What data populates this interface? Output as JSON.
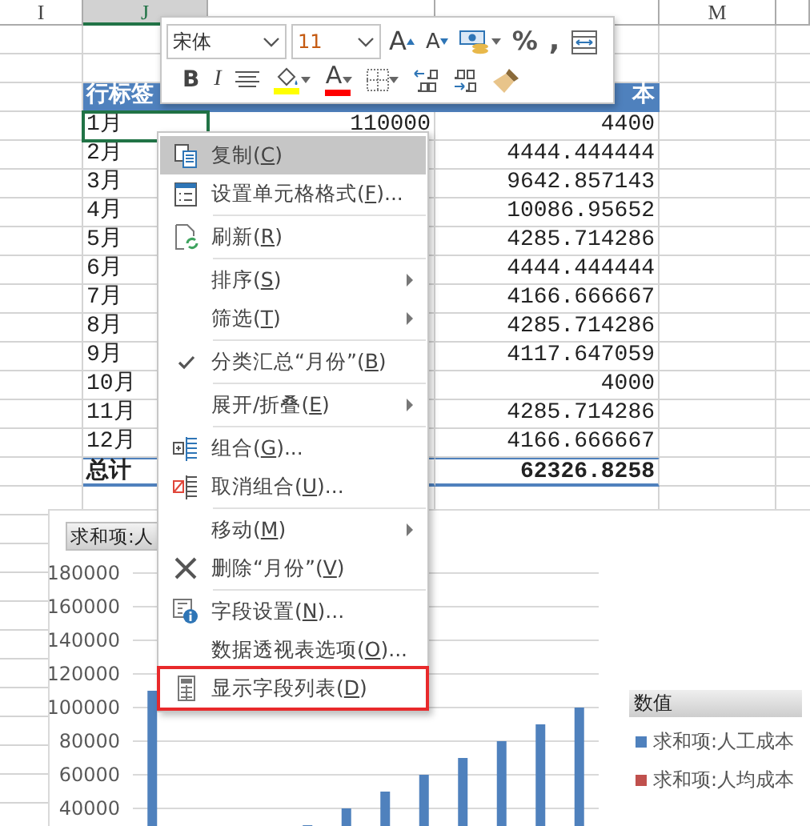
{
  "columns": [
    {
      "label": "I",
      "selected": false
    },
    {
      "label": "J",
      "selected": true
    },
    {
      "selected": false
    },
    {
      "selected": false
    },
    {
      "label": "M",
      "selected": false
    }
  ],
  "pivot": {
    "row_header": "行标签",
    "value_header_tail": "本",
    "rows": [
      {
        "label": "1月",
        "column_k": "110000",
        "column_l": "4400",
        "selected": true
      },
      {
        "label": "2月",
        "column_l": "4444.444444",
        "selected": false
      },
      {
        "label": "3月",
        "column_l": "9642.857143",
        "selected": false
      },
      {
        "label": "4月",
        "column_l": "10086.95652",
        "selected": false
      },
      {
        "label": "5月",
        "column_l": "4285.714286",
        "selected": false
      },
      {
        "label": "6月",
        "column_l": "4444.444444",
        "selected": false
      },
      {
        "label": "7月",
        "column_l": "4166.666667",
        "selected": false
      },
      {
        "label": "8月",
        "column_l": "4285.714286",
        "selected": false
      },
      {
        "label": "9月",
        "column_l": "4117.647059",
        "selected": false
      },
      {
        "label": "10月",
        "column_l": "4000",
        "selected": false
      },
      {
        "label": "11月",
        "column_l": "4285.714286",
        "selected": false
      },
      {
        "label": "12月",
        "column_l": "4166.666667",
        "selected": false
      }
    ],
    "total": {
      "label": "总计",
      "column_l": "62326.8258"
    }
  },
  "mini_toolbar": {
    "font": "宋体",
    "size": "11",
    "grow_glyph": "A",
    "shrink_glyph": "A",
    "percent_glyph": "%",
    "comma_glyph": ",",
    "bold_glyph": "B",
    "italic_glyph": "I",
    "font_color_glyph": "A"
  },
  "context_menu": {
    "items": [
      {
        "kind": "copy",
        "before": "复制(",
        "key": "C",
        "after": ")",
        "checked": false,
        "submenu": false,
        "selected": true,
        "outlined": false
      },
      {
        "kind": "format",
        "before": "设置单元格格式(",
        "key": "F",
        "after": ")...",
        "checked": false,
        "submenu": false,
        "selected": false,
        "outlined": false
      },
      {
        "kind": "separator"
      },
      {
        "kind": "refresh",
        "before": "刷新(",
        "key": "R",
        "after": ")",
        "checked": false,
        "submenu": false,
        "selected": false,
        "outlined": false
      },
      {
        "kind": "separator"
      },
      {
        "kind": "plain",
        "before": "排序(",
        "key": "S",
        "after": ")",
        "checked": false,
        "submenu": true,
        "selected": false,
        "outlined": false
      },
      {
        "kind": "plain",
        "before": "筛选(",
        "key": "T",
        "after": ")",
        "checked": false,
        "submenu": true,
        "selected": false,
        "outlined": false
      },
      {
        "kind": "separator"
      },
      {
        "kind": "plain",
        "before": "分类汇总“月份”(",
        "key": "B",
        "after": ")",
        "checked": true,
        "submenu": false,
        "selected": false,
        "outlined": false
      },
      {
        "kind": "separator"
      },
      {
        "kind": "plain",
        "before": "展开/折叠(",
        "key": "E",
        "after": ")",
        "checked": false,
        "submenu": true,
        "selected": false,
        "outlined": false
      },
      {
        "kind": "separator"
      },
      {
        "kind": "group",
        "before": "组合(",
        "key": "G",
        "after": ")...",
        "checked": false,
        "submenu": false,
        "selected": false,
        "outlined": false
      },
      {
        "kind": "ungroup",
        "before": "取消组合(",
        "key": "U",
        "after": ")...",
        "checked": false,
        "submenu": false,
        "selected": false,
        "outlined": false
      },
      {
        "kind": "separator"
      },
      {
        "kind": "plain",
        "before": "移动(",
        "key": "M",
        "after": ")",
        "checked": false,
        "submenu": true,
        "selected": false,
        "outlined": false
      },
      {
        "kind": "delete",
        "before": "删除“月份”(",
        "key": "V",
        "after": ")",
        "checked": false,
        "submenu": false,
        "selected": false,
        "outlined": false
      },
      {
        "kind": "separator"
      },
      {
        "kind": "settings",
        "before": "字段设置(",
        "key": "N",
        "after": ")...",
        "checked": false,
        "submenu": false,
        "selected": false,
        "outlined": false
      },
      {
        "kind": "plain",
        "before": "数据透视表选项(",
        "key": "O",
        "after": ")...",
        "checked": false,
        "submenu": false,
        "selected": false,
        "outlined": false
      },
      {
        "kind": "list",
        "before": "显示字段列表(",
        "key": "D",
        "after": ")",
        "checked": false,
        "submenu": false,
        "selected": false,
        "outlined": true
      }
    ]
  },
  "chart": {
    "field_button": "求和项:人",
    "legend_title": "数值",
    "chart_data": {
      "type": "bar",
      "grid": true,
      "ylim": [
        0,
        180000
      ],
      "yticks": [
        40000,
        60000,
        80000,
        100000,
        120000,
        140000,
        160000,
        180000
      ],
      "series": [
        {
          "name": "求和项:人工成本",
          "color": "#4f81bd",
          "values": [
            110000,
            null,
            null,
            null,
            30000,
            40000,
            50000,
            60000,
            70000,
            80000,
            90000,
            100000
          ]
        },
        {
          "name": "求和项:人均成本",
          "color": "#c0504d",
          "values": [
            null,
            null,
            null,
            null,
            null,
            null,
            null,
            null,
            null,
            null,
            null,
            null
          ]
        }
      ]
    }
  }
}
